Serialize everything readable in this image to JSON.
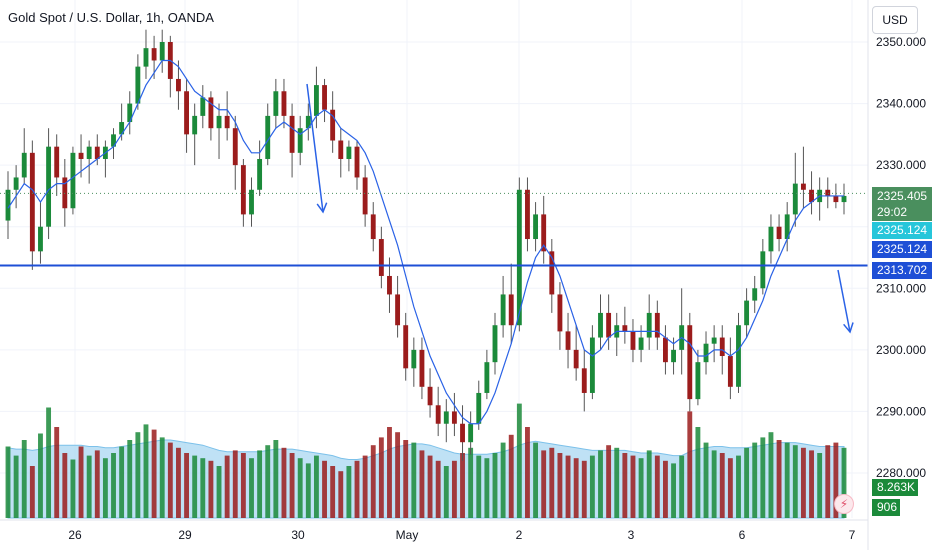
{
  "header": {
    "title": "Gold Spot / U.S. Dollar, 1h, OANDA",
    "currency": "USD"
  },
  "badges": {
    "last_price": "2325.405",
    "countdown": "29:02",
    "ma_value": "2325.124",
    "ma_value2": "2325.124",
    "hline_value": "2313.702",
    "volume_ma": "8.263K",
    "volume": "906"
  },
  "colors": {
    "up": "#1b8a3a",
    "down": "#9b1c1c",
    "ma": "#2a62e6",
    "hline": "#1e4fd6",
    "volume_area": "#a9d7f2",
    "last_price_badge": "#4a8f5e",
    "ma_badge": "#26c6da",
    "hline_badge": "#1e4fd6",
    "volume_badge": "#1b8a3a"
  },
  "icons": {
    "lightning": "lightning-icon"
  },
  "chart_data": {
    "type": "candlestick",
    "ylim": [
      2277,
      2352
    ],
    "y_ticks": [
      "2350.000",
      "2340.000",
      "2330.000",
      "2320.000",
      "2310.000",
      "2300.000",
      "2290.000",
      "2280.000"
    ],
    "x_tick_labels": [
      "26",
      "29",
      "30",
      "May",
      "2",
      "3",
      "6",
      "7"
    ],
    "horizontal_line": 2313.702,
    "last_price": 2325.405,
    "annotations": [
      "arrow-down-1",
      "arrow-down-2"
    ],
    "ohlc": [
      [
        2321,
        2329,
        2318,
        2326
      ],
      [
        2326,
        2330,
        2323,
        2328
      ],
      [
        2328,
        2336,
        2327,
        2332
      ],
      [
        2332,
        2334,
        2313,
        2316
      ],
      [
        2316,
        2324,
        2314,
        2320
      ],
      [
        2320,
        2336,
        2318,
        2333
      ],
      [
        2333,
        2335,
        2325,
        2328
      ],
      [
        2328,
        2331,
        2320,
        2323
      ],
      [
        2323,
        2333,
        2322,
        2332
      ],
      [
        2332,
        2335,
        2328,
        2331
      ],
      [
        2331,
        2334,
        2327,
        2333
      ],
      [
        2333,
        2335,
        2330,
        2331
      ],
      [
        2331,
        2334,
        2328,
        2333
      ],
      [
        2333,
        2336,
        2331,
        2335
      ],
      [
        2335,
        2340,
        2334,
        2337
      ],
      [
        2337,
        2342,
        2335,
        2340
      ],
      [
        2340,
        2348,
        2339,
        2346
      ],
      [
        2346,
        2352,
        2344,
        2349
      ],
      [
        2349,
        2351,
        2344,
        2347
      ],
      [
        2347,
        2352,
        2345,
        2350
      ],
      [
        2350,
        2351,
        2341,
        2344
      ],
      [
        2344,
        2347,
        2339,
        2342
      ],
      [
        2342,
        2344,
        2332,
        2335
      ],
      [
        2335,
        2340,
        2330,
        2338
      ],
      [
        2338,
        2343,
        2336,
        2341
      ],
      [
        2341,
        2342,
        2334,
        2336
      ],
      [
        2336,
        2340,
        2331,
        2338
      ],
      [
        2338,
        2342,
        2334,
        2336
      ],
      [
        2336,
        2338,
        2326,
        2330
      ],
      [
        2330,
        2331,
        2320,
        2322
      ],
      [
        2322,
        2328,
        2320,
        2326
      ],
      [
        2326,
        2334,
        2325,
        2331
      ],
      [
        2331,
        2340,
        2330,
        2338
      ],
      [
        2338,
        2344,
        2336,
        2342
      ],
      [
        2342,
        2344,
        2336,
        2338
      ],
      [
        2338,
        2340,
        2328,
        2332
      ],
      [
        2332,
        2338,
        2330,
        2336
      ],
      [
        2336,
        2340,
        2334,
        2338
      ],
      [
        2338,
        2346,
        2336,
        2343
      ],
      [
        2343,
        2344,
        2337,
        2339
      ],
      [
        2339,
        2342,
        2332,
        2334
      ],
      [
        2334,
        2336,
        2328,
        2331
      ],
      [
        2331,
        2334,
        2329,
        2333
      ],
      [
        2333,
        2334,
        2326,
        2328
      ],
      [
        2328,
        2330,
        2320,
        2322
      ],
      [
        2322,
        2324,
        2316,
        2318
      ],
      [
        2318,
        2320,
        2310,
        2312
      ],
      [
        2312,
        2315,
        2306,
        2309
      ],
      [
        2309,
        2312,
        2302,
        2304
      ],
      [
        2304,
        2306,
        2295,
        2297
      ],
      [
        2297,
        2302,
        2294,
        2300
      ],
      [
        2300,
        2302,
        2292,
        2294
      ],
      [
        2294,
        2297,
        2289,
        2291
      ],
      [
        2291,
        2294,
        2286,
        2288
      ],
      [
        2288,
        2292,
        2285,
        2290
      ],
      [
        2290,
        2293,
        2286,
        2288
      ],
      [
        2288,
        2291,
        2282,
        2285
      ],
      [
        2285,
        2290,
        2283,
        2288
      ],
      [
        2288,
        2295,
        2287,
        2293
      ],
      [
        2293,
        2300,
        2292,
        2298
      ],
      [
        2298,
        2306,
        2296,
        2304
      ],
      [
        2304,
        2312,
        2302,
        2309
      ],
      [
        2309,
        2314,
        2301,
        2304
      ],
      [
        2304,
        2328,
        2303,
        2326
      ],
      [
        2326,
        2328,
        2316,
        2318
      ],
      [
        2318,
        2324,
        2316,
        2322
      ],
      [
        2322,
        2325,
        2314,
        2316
      ],
      [
        2316,
        2318,
        2306,
        2309
      ],
      [
        2309,
        2311,
        2300,
        2303
      ],
      [
        2303,
        2306,
        2297,
        2300
      ],
      [
        2300,
        2304,
        2295,
        2297
      ],
      [
        2297,
        2300,
        2290,
        2293
      ],
      [
        2293,
        2304,
        2292,
        2302
      ],
      [
        2302,
        2309,
        2300,
        2306
      ],
      [
        2306,
        2309,
        2300,
        2302
      ],
      [
        2302,
        2306,
        2299,
        2304
      ],
      [
        2304,
        2307,
        2301,
        2303
      ],
      [
        2303,
        2305,
        2298,
        2300
      ],
      [
        2300,
        2304,
        2298,
        2302
      ],
      [
        2302,
        2309,
        2300,
        2306
      ],
      [
        2306,
        2308,
        2300,
        2302
      ],
      [
        2302,
        2304,
        2296,
        2298
      ],
      [
        2298,
        2302,
        2296,
        2300
      ],
      [
        2300,
        2310,
        2296,
        2304
      ],
      [
        2304,
        2306,
        2290,
        2292
      ],
      [
        2292,
        2300,
        2291,
        2298
      ],
      [
        2298,
        2303,
        2296,
        2301
      ],
      [
        2301,
        2304,
        2298,
        2302
      ],
      [
        2302,
        2304,
        2296,
        2299
      ],
      [
        2299,
        2302,
        2292,
        2294
      ],
      [
        2294,
        2306,
        2293,
        2304
      ],
      [
        2304,
        2310,
        2302,
        2308
      ],
      [
        2308,
        2312,
        2306,
        2310
      ],
      [
        2310,
        2318,
        2309,
        2316
      ],
      [
        2316,
        2322,
        2314,
        2320
      ],
      [
        2320,
        2322,
        2316,
        2318
      ],
      [
        2318,
        2324,
        2316,
        2322
      ],
      [
        2322,
        2332,
        2320,
        2327
      ],
      [
        2327,
        2333,
        2323,
        2326
      ],
      [
        2326,
        2329,
        2322,
        2324
      ],
      [
        2324,
        2328,
        2321,
        2326
      ],
      [
        2326,
        2328,
        2323,
        2325
      ],
      [
        2325,
        2327,
        2323,
        2324
      ],
      [
        2324,
        2327,
        2322,
        2325
      ]
    ],
    "ma": [
      2323,
      2325,
      2327,
      2326,
      2324,
      2326,
      2327,
      2327,
      2328,
      2329,
      2330,
      2331,
      2332,
      2333,
      2335,
      2337,
      2340,
      2343,
      2345,
      2347,
      2347,
      2346,
      2344,
      2342,
      2341,
      2340,
      2339,
      2339,
      2337,
      2334,
      2332,
      2332,
      2334,
      2336,
      2337,
      2336,
      2335,
      2336,
      2338,
      2339,
      2338,
      2336,
      2335,
      2334,
      2332,
      2329,
      2325,
      2321,
      2317,
      2312,
      2307,
      2303,
      2299,
      2296,
      2293,
      2291,
      2289,
      2288,
      2288,
      2290,
      2293,
      2297,
      2301,
      2306,
      2311,
      2315,
      2317,
      2315,
      2312,
      2308,
      2304,
      2300,
      2299,
      2300,
      2302,
      2303,
      2303,
      2303,
      2303,
      2303,
      2303,
      2302,
      2301,
      2302,
      2301,
      2299,
      2299,
      2300,
      2300,
      2299,
      2300,
      2302,
      2305,
      2308,
      2312,
      2315,
      2318,
      2321,
      2323,
      2324,
      2325,
      2325,
      2325,
      2325
    ],
    "volume": [
      55,
      48,
      60,
      40,
      65,
      85,
      70,
      50,
      45,
      55,
      48,
      52,
      46,
      50,
      55,
      60,
      66,
      72,
      68,
      62,
      58,
      54,
      50,
      48,
      46,
      44,
      40,
      48,
      52,
      50,
      46,
      52,
      56,
      60,
      54,
      50,
      46,
      42,
      48,
      44,
      40,
      36,
      40,
      44,
      48,
      56,
      62,
      70,
      66,
      60,
      58,
      52,
      48,
      44,
      40,
      44,
      50,
      54,
      48,
      46,
      50,
      58,
      64,
      88,
      70,
      58,
      52,
      54,
      50,
      48,
      46,
      44,
      48,
      52,
      56,
      54,
      50,
      48,
      46,
      52,
      48,
      44,
      42,
      48,
      82,
      70,
      58,
      52,
      50,
      46,
      48,
      54,
      58,
      62,
      66,
      60,
      58,
      56,
      54,
      52,
      50,
      56,
      58,
      54
    ],
    "volume_ma": [
      54,
      53,
      53,
      52,
      53,
      55,
      56,
      56,
      56,
      56,
      55,
      55,
      54,
      54,
      55,
      56,
      57,
      58,
      59,
      60,
      60,
      59,
      58,
      57,
      56,
      54,
      52,
      51,
      51,
      51,
      51,
      51,
      52,
      53,
      53,
      53,
      52,
      51,
      50,
      49,
      48,
      46,
      45,
      45,
      46,
      48,
      50,
      53,
      55,
      56,
      57,
      57,
      56,
      54,
      52,
      50,
      49,
      49,
      49,
      49,
      50,
      51,
      53,
      56,
      58,
      59,
      58,
      57,
      56,
      55,
      54,
      53,
      52,
      52,
      52,
      52,
      52,
      51,
      50,
      50,
      50,
      49,
      48,
      48,
      51,
      53,
      54,
      55,
      55,
      54,
      54,
      54,
      55,
      56,
      57,
      58,
      58,
      58,
      57,
      56,
      55,
      55,
      55,
      55
    ],
    "volume_scale_max": 100
  }
}
